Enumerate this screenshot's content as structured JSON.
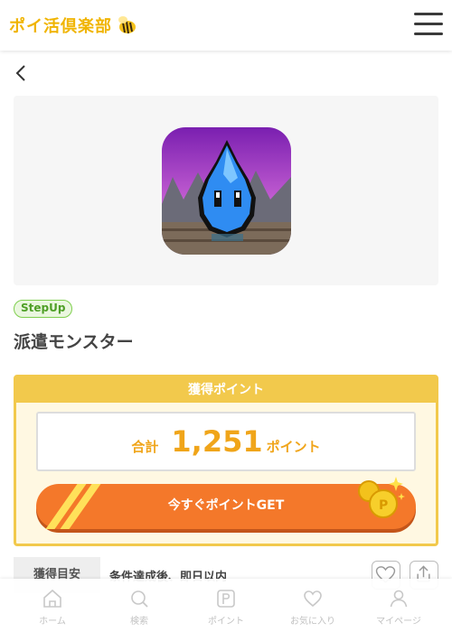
{
  "header": {
    "logo_text": "ポイ活倶楽部",
    "menu_icon": "hamburger-menu-icon"
  },
  "back_icon": "chevron-left-icon",
  "app": {
    "tag": "StepUp",
    "title": "派遣モンスター"
  },
  "points": {
    "header": "獲得ポイント",
    "total_label": "合計",
    "total_value": "1,251",
    "unit": "ポイント",
    "cta_label": "今すぐポイントGET"
  },
  "info": {
    "label": "獲得目安",
    "value": "条件達成後、即日以内"
  },
  "bottom_nav": [
    {
      "label": "ホーム",
      "icon": "home-icon"
    },
    {
      "label": "検索",
      "icon": "search-icon"
    },
    {
      "label": "ポイント",
      "icon": "point-icon"
    },
    {
      "label": "お気に入り",
      "icon": "heart-icon"
    },
    {
      "label": "マイページ",
      "icon": "person-icon"
    }
  ],
  "colors": {
    "brand_yellow": "#f2c94c",
    "cta_orange": "#f4782a",
    "point_text": "#f0a51a",
    "tag_green": "#7fcf4e"
  }
}
